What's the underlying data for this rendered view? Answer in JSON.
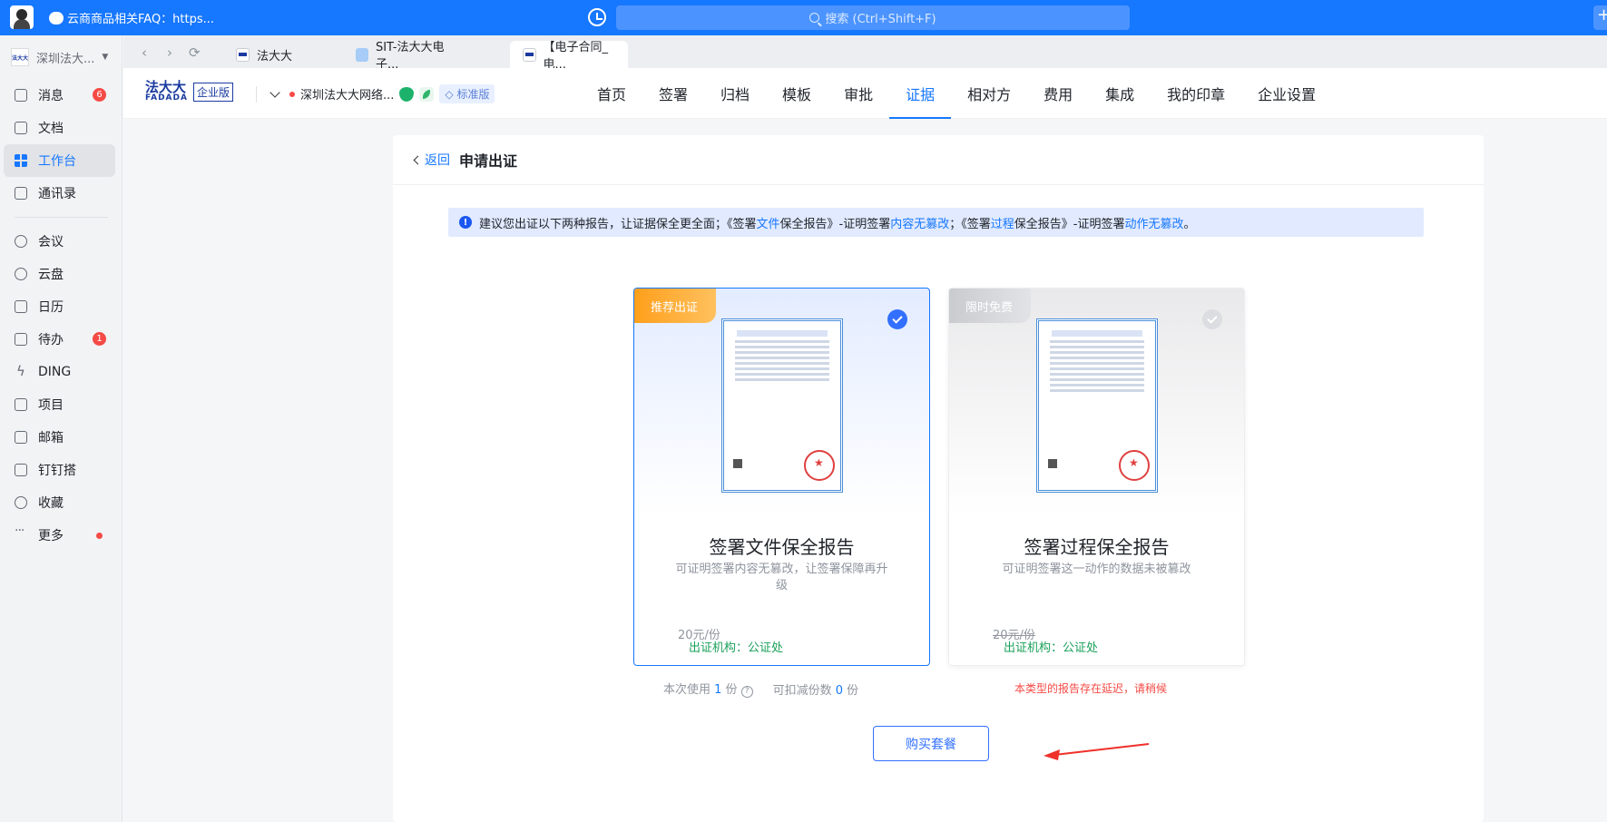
{
  "topbar": {
    "chat_title": "云商商品相关FAQ：https...",
    "search_placeholder": "搜索 (Ctrl+Shift+F)",
    "plus": "+"
  },
  "sidebar": {
    "org_name": "深圳法大...",
    "org_logo": "法大大",
    "items": [
      {
        "label": "消息",
        "badge": "6",
        "icon": "message-icon"
      },
      {
        "label": "文档",
        "icon": "document-icon"
      },
      {
        "label": "工作台",
        "icon": "workbench-icon",
        "active": true
      },
      {
        "label": "通讯录",
        "icon": "contacts-icon"
      },
      {
        "label": "会议",
        "icon": "meeting-icon"
      },
      {
        "label": "云盘",
        "icon": "cloud-icon"
      },
      {
        "label": "日历",
        "icon": "calendar-icon"
      },
      {
        "label": "待办",
        "badge": "1",
        "icon": "todo-icon"
      },
      {
        "label": "DING",
        "icon": "ding-icon"
      },
      {
        "label": "项目",
        "icon": "project-icon"
      },
      {
        "label": "邮箱",
        "icon": "mail-icon"
      },
      {
        "label": "钉钉搭",
        "icon": "dingda-icon"
      },
      {
        "label": "收藏",
        "icon": "favorite-icon"
      },
      {
        "label": "更多",
        "icon": "more-icon",
        "dot": true
      }
    ]
  },
  "tabs": [
    {
      "label": "法大大"
    },
    {
      "label": "SIT-法大大电子..."
    },
    {
      "label": "【电子合同_电..."
    }
  ],
  "app": {
    "brand_cn": "法大大",
    "brand_en": "FADADA",
    "edition": "企业版",
    "company": "深圳法大大网络...",
    "plan": "标准版",
    "nav": [
      "首页",
      "签署",
      "归档",
      "模板",
      "审批",
      "证据",
      "相对方",
      "费用",
      "集成",
      "我的印章",
      "企业设置"
    ],
    "active_nav": "证据"
  },
  "panel": {
    "back": "返回",
    "title": "申请出证",
    "notice": {
      "p1": "建议您出证以下两种报告，让证据保全更全面；《签署",
      "h1": "文件",
      "p2": "保全报告》-证明签署",
      "h2": "内容无篡改",
      "p3": "；《签署",
      "h3": "过程",
      "p4": "保全报告》-证明签署",
      "h4": "动作无篡改",
      "p5": "。"
    },
    "cards": [
      {
        "tag": "推荐出证",
        "title": "签署文件保全报告",
        "desc": "可证明签署内容无篡改，让签署保障再升级",
        "org": "出证机构：公证处",
        "price": "20元/份",
        "selected": true
      },
      {
        "tag": "限时免费",
        "title": "签署过程保全报告",
        "desc": "可证明签署这一动作的数据未被篡改",
        "org": "出证机构：公证处",
        "price": "20元/份",
        "selected": false
      }
    ],
    "usage": {
      "this_use_prefix": "本次使用",
      "this_use_num": "1",
      "this_use_unit": "份",
      "deduct_prefix": "可扣减份数",
      "deduct_num": "0",
      "deduct_unit": "份"
    },
    "delay_note": "本类型的报告存在延迟，请稍候",
    "buy_button": "购买套餐"
  },
  "colors": {
    "primary": "#1677ff",
    "warning_tag": "#ff9f1c",
    "success": "#1aa05a",
    "danger": "#f54a45"
  }
}
